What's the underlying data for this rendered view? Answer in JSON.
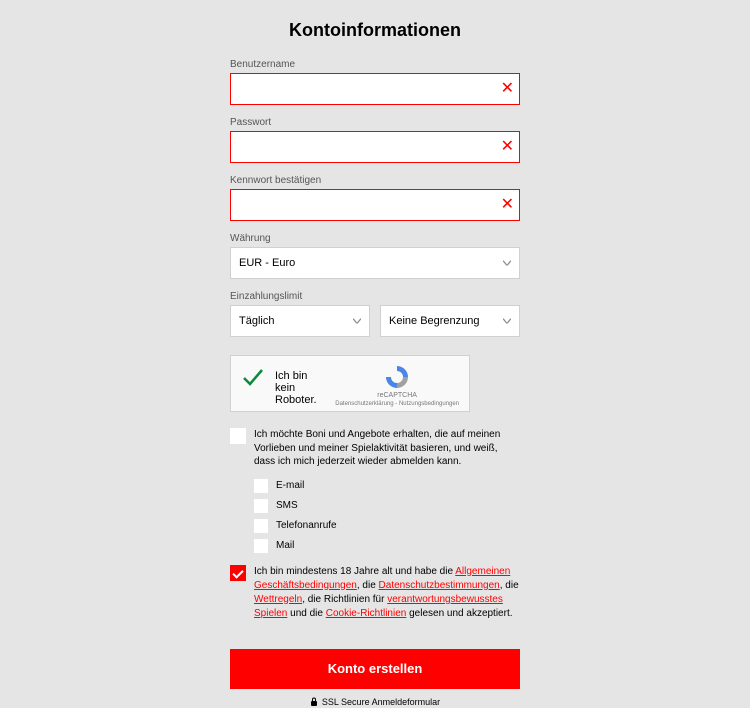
{
  "title": "Kontoinformationen",
  "fields": {
    "username_label": "Benutzername",
    "password_label": "Passwort",
    "confirm_label": "Kennwort bestätigen",
    "currency_label": "Währung",
    "currency_value": "EUR - Euro",
    "deposit_limit_label": "Einzahlungslimit",
    "period_value": "Täglich",
    "limit_value": "Keine Begrenzung"
  },
  "captcha": {
    "text": "Ich bin kein Roboter.",
    "brand": "reCAPTCHA",
    "links": "Datenschutzerklärung - Nutzungsbedingungen"
  },
  "bonus": {
    "text": "Ich möchte Boni und Angebote erhalten, die auf meinen Vorlieben und meiner Spielaktivität basieren, und weiß, dass ich mich jederzeit wieder abmelden kann.",
    "opts": {
      "email": "E-mail",
      "sms": "SMS",
      "phone": "Telefonanrufe",
      "mail": "Mail"
    }
  },
  "terms": {
    "prefix": "Ich bin mindestens 18 Jahre alt und habe die ",
    "agb": "Allgemeinen Geschäftsbedingungen",
    "sep1": ", die ",
    "privacy": "Datenschutzbestimmungen",
    "sep2": ", die ",
    "betting": "Wettregeln",
    "sep3": ", die Richtlinien für ",
    "responsible": "verantwortungsbewusstes Spielen",
    "sep4": " und die ",
    "cookie": "Cookie-Richtlinien",
    "suffix": " gelesen und akzeptiert."
  },
  "submit": "Konto erstellen",
  "ssl": "SSL Secure Anmeldeformular"
}
